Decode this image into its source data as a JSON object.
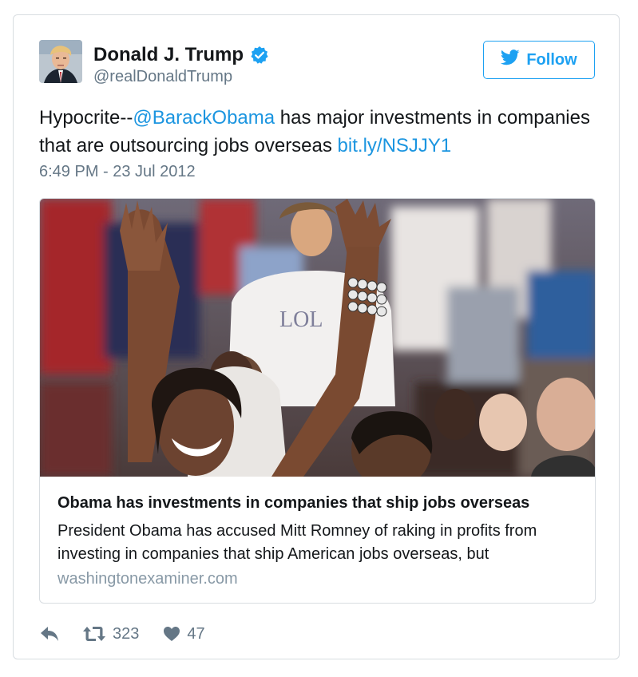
{
  "tweet": {
    "author_name": "Donald J. Trump",
    "handle": "@realDonaldTrump",
    "follow_label": "Follow",
    "text_before": "Hypocrite--",
    "mention": "@BarackObama",
    "text_middle": " has major investments in companies that are outsourcing jobs overseas ",
    "short_link": "bit.ly/NSJJY1",
    "timestamp": "6:49 PM - 23 Jul 2012"
  },
  "link_card": {
    "title": "Obama has investments in companies that ship jobs overseas",
    "description": "President Obama has accused Mitt Romney of raking in profits from investing in companies that ship American jobs overseas, but",
    "domain": "washingtonexaminer.com"
  },
  "actions": {
    "retweet_count": "323",
    "like_count": "47"
  },
  "colors": {
    "accent": "#1da1f2",
    "link": "#1b95e0",
    "secondary_text": "#657786",
    "border": "#d8dde1"
  },
  "icons": [
    "verified-badge-icon",
    "twitter-bird-icon",
    "reply-icon",
    "retweet-icon",
    "heart-icon"
  ]
}
